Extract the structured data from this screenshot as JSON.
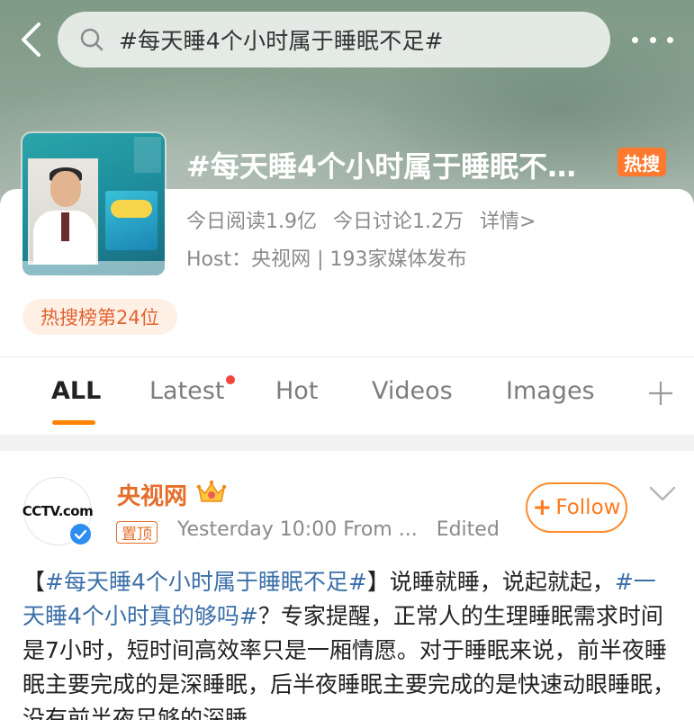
{
  "header": {
    "search_text": "#每天睡4个小时属于睡眠不足#",
    "back_icon": "chevron-left-icon",
    "more_icon": "more-dots-icon"
  },
  "topic": {
    "title": "#每天睡4个小时属于睡眠不足...",
    "hot_badge": "热搜",
    "reads_today": "今日阅读1.9亿",
    "discussions_today": "今日讨论1.2万",
    "details_link": "详情>",
    "host_label": "Host：央视网 | 193家媒体发布",
    "rank": "热搜榜第24位"
  },
  "tabs": {
    "items": [
      "ALL",
      "Latest",
      "Hot",
      "Videos",
      "Images"
    ],
    "active": "ALL",
    "add_icon": "plus-icon"
  },
  "post": {
    "author": "央视网",
    "avatar_text": "CCTV.com",
    "pinned_label": "置顶",
    "time": "Yesterday 10:00",
    "source": "From ...",
    "edited": "Edited",
    "follow_label": "Follow",
    "body": {
      "bracket_open": "【",
      "tag1": "#每天睡4个小时属于睡眠不足#",
      "text1": "】说睡就睡，说起就起，",
      "tag2": "#一天睡4个小时真的够吗#",
      "text2": "？专家提醒，正常人的生理睡眠需求时间是7小时，短时间高效率只是一厢情愿。对于睡眠来说，前半夜睡眠主要完成的是深睡眠，后半夜睡眠主要完成的是快速动眼睡眠，没有前半夜足够的深睡"
    }
  },
  "colors": {
    "accent_orange": "#ff8200",
    "author_orange": "#e46e2a",
    "hot_badge": "#ff7a2f",
    "tag_blue": "#3b6fa8",
    "verified_blue": "#2d8ef0"
  }
}
